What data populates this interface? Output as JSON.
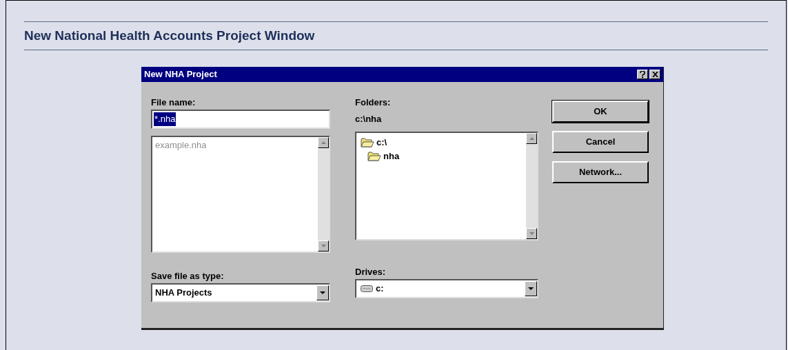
{
  "page": {
    "heading": "New National Health Accounts Project Window"
  },
  "dialog": {
    "title": "New NHA Project",
    "file_name": {
      "label": "File name:",
      "value": "*.nha"
    },
    "files": [
      {
        "name": "example.nha",
        "disabled": true
      }
    ],
    "folders": {
      "label": "Folders:",
      "path": "c:\\nha",
      "tree": [
        {
          "name": "c:\\",
          "children": [
            {
              "name": "nha"
            }
          ]
        }
      ]
    },
    "save_type": {
      "label": "Save file as type:",
      "value": "NHA Projects"
    },
    "drives": {
      "label": "Drives:",
      "value": "c:"
    },
    "buttons": [
      "OK",
      "Cancel",
      "Network..."
    ]
  }
}
